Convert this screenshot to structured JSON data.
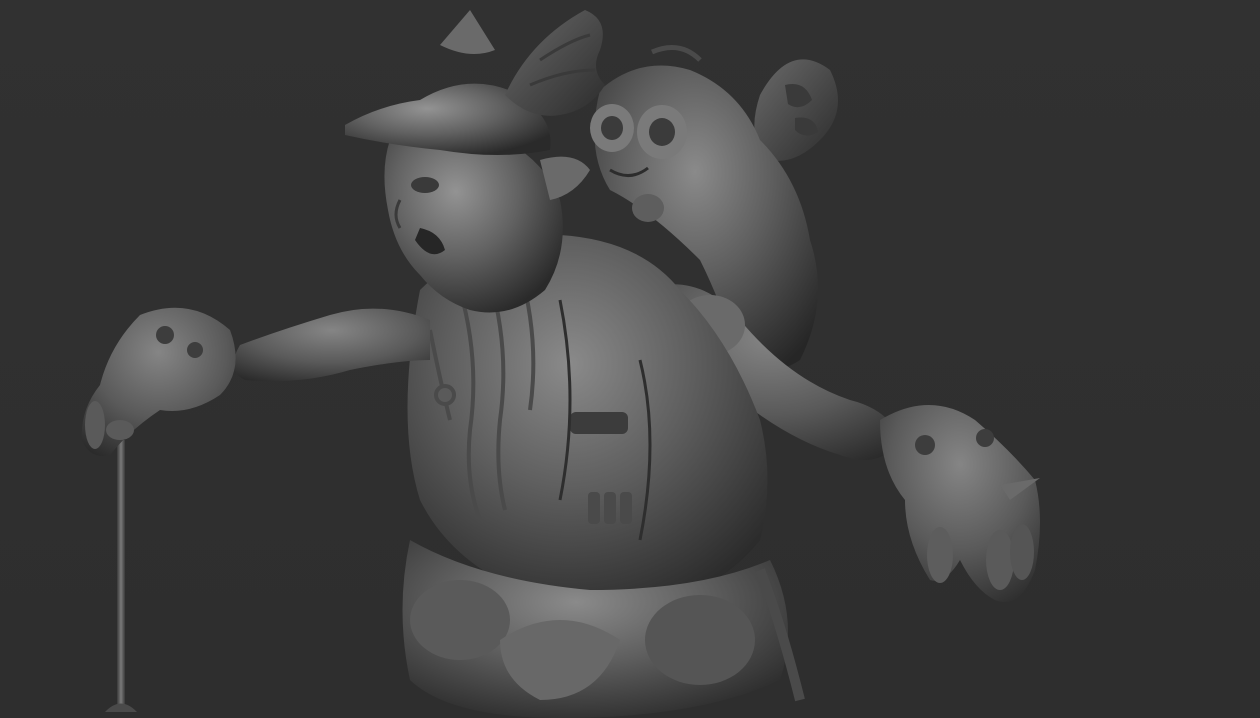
{
  "viewport": {
    "background_color": "#303030",
    "material_base_color": "#5a5a5a",
    "material_shadow_color": "#232323",
    "material_highlight_color": "#8a8a8a"
  },
  "scene": {
    "subject": "grey-clay-sculpt",
    "visible_parts": [
      "goblin-head",
      "winged-cap",
      "frog-companion",
      "butterfly-wing",
      "torso-vest",
      "left-arm",
      "right-arm",
      "left-glove",
      "right-glove",
      "staff",
      "belt-and-pouches",
      "cables-and-necklace"
    ]
  }
}
